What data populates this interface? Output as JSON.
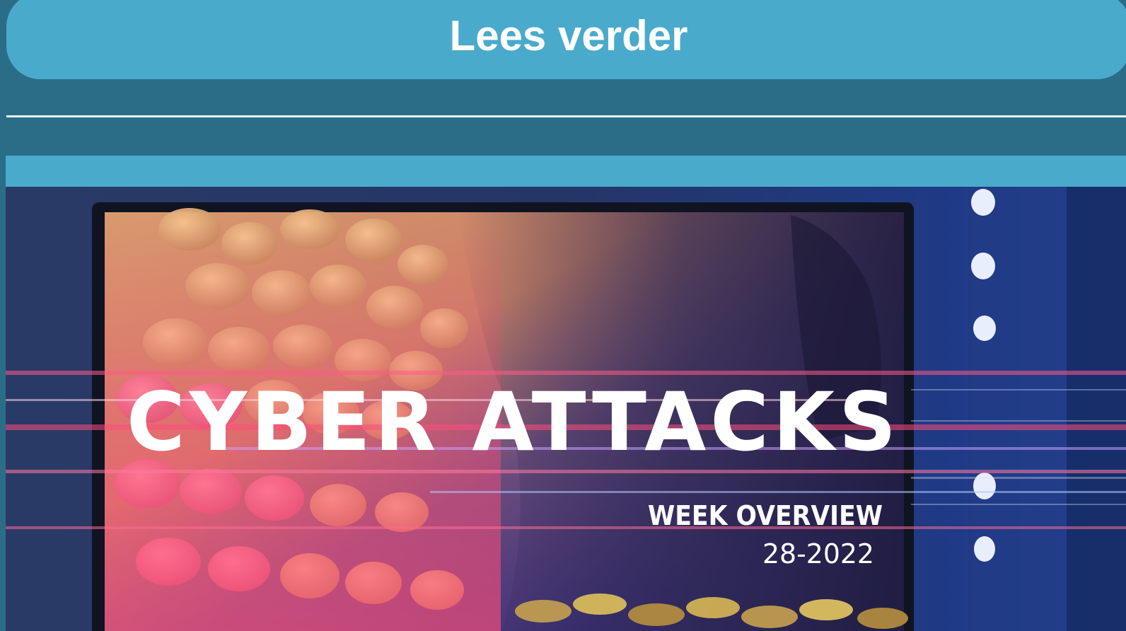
{
  "read_more": {
    "label": "Lees verder"
  },
  "article": {
    "image": {
      "headline": "CYBER ATTACKS",
      "subtitle": "WEEK OVERVIEW",
      "week": "28-2022"
    }
  },
  "colors": {
    "page_background": "#2b6d87",
    "button_background": "#4aaacb",
    "divider": "#f2f6f8",
    "headline_text": "#ffffff"
  }
}
